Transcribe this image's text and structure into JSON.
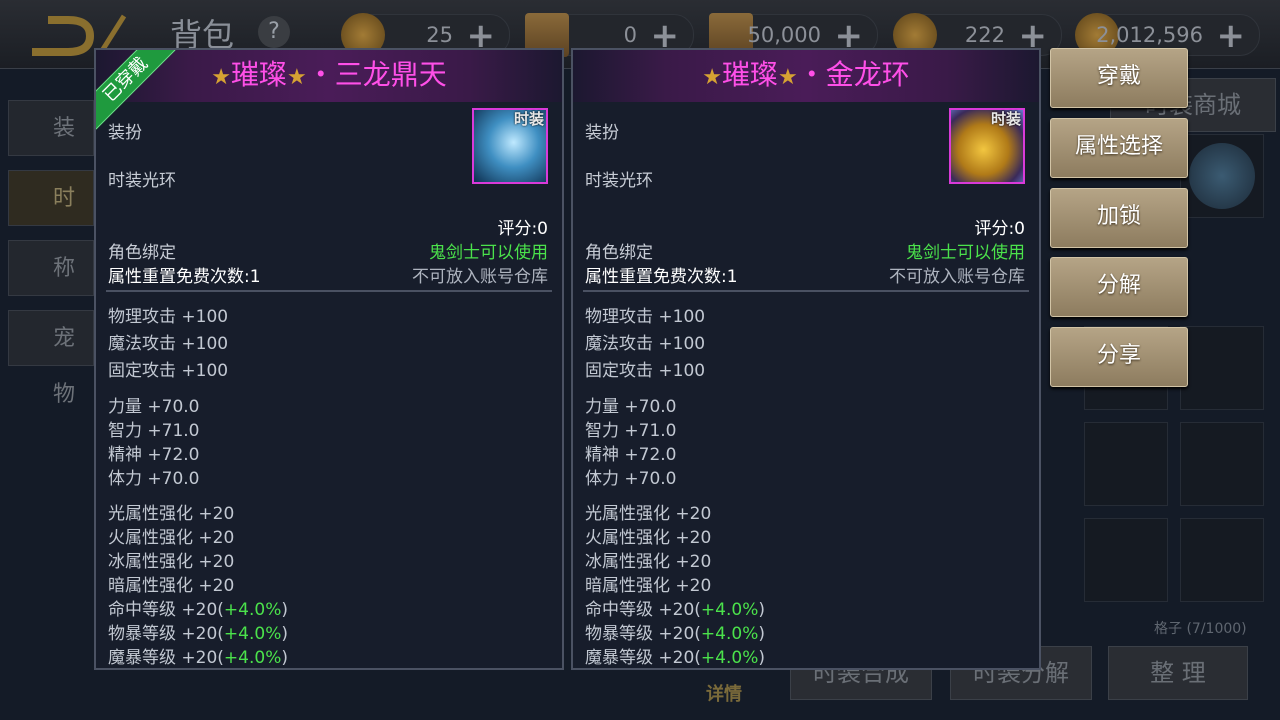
{
  "header": {
    "title": "背包",
    "help": "?",
    "currencies": [
      {
        "icon": "coin-icon",
        "value": "25"
      },
      {
        "icon": "scroll-icon",
        "value": "0"
      },
      {
        "icon": "scroll-icon",
        "value": "50,000"
      },
      {
        "icon": "coin-icon",
        "value": "222"
      },
      {
        "icon": "gold-coin-icon",
        "value": "2,012,596"
      }
    ],
    "plus": "+"
  },
  "sidebar": {
    "tabs": [
      {
        "label": "装备"
      },
      {
        "label": "时装"
      },
      {
        "label": "称号"
      },
      {
        "label": "宠物"
      }
    ]
  },
  "background": {
    "shop_label": "时装商城",
    "slot_count": "格子 (7/1000)",
    "bottom_buttons": [
      "时装合成",
      "时装分解",
      "整 理"
    ],
    "detail_link": "详情"
  },
  "panels": [
    {
      "star": "★",
      "rarity": "璀璨",
      "name": "・三龙鼎天",
      "worn": "已穿戴",
      "icon_tag": "时装",
      "type": "装扮",
      "subtype": "时装光环",
      "score": "评分:0",
      "bind": "角色绑定",
      "usable": "鬼剑士可以使用",
      "reset": "属性重置免费次数:1",
      "storage": "不可放入账号仓库",
      "attack": [
        "物理攻击 +100",
        "魔法攻击 +100",
        "固定攻击 +100"
      ],
      "attrs": [
        "力量 +70.0",
        "智力 +71.0",
        "精神 +72.0",
        "体力 +70.0"
      ],
      "elements": [
        "光属性强化 +20",
        "火属性强化 +20",
        "冰属性强化 +20",
        "暗属性强化 +20"
      ],
      "ratings": [
        {
          "text": "命中等级 +20(",
          "bonus": "+4.0%",
          "close": ")"
        },
        {
          "text": "物暴等级 +20(",
          "bonus": "+4.0%",
          "close": ")"
        },
        {
          "text": "魔暴等级 +20(",
          "bonus": "+4.0%",
          "close": ")"
        }
      ]
    },
    {
      "star": "★",
      "rarity": "璀璨",
      "name": "・金龙环",
      "icon_tag": "时装",
      "type": "装扮",
      "subtype": "时装光环",
      "score": "评分:0",
      "bind": "角色绑定",
      "usable": "鬼剑士可以使用",
      "reset": "属性重置免费次数:1",
      "storage": "不可放入账号仓库",
      "attack": [
        "物理攻击 +100",
        "魔法攻击 +100",
        "固定攻击 +100"
      ],
      "attrs": [
        "力量 +70.0",
        "智力 +71.0",
        "精神 +72.0",
        "体力 +70.0"
      ],
      "elements": [
        "光属性强化 +20",
        "火属性强化 +20",
        "冰属性强化 +20",
        "暗属性强化 +20"
      ],
      "ratings": [
        {
          "text": "命中等级 +20(",
          "bonus": "+4.0%",
          "close": ")"
        },
        {
          "text": "物暴等级 +20(",
          "bonus": "+4.0%",
          "close": ")"
        },
        {
          "text": "魔暴等级 +20(",
          "bonus": "+4.0%",
          "close": ")"
        }
      ]
    }
  ],
  "actions": [
    "穿戴",
    "属性选择",
    "加锁",
    "分解",
    "分享"
  ]
}
